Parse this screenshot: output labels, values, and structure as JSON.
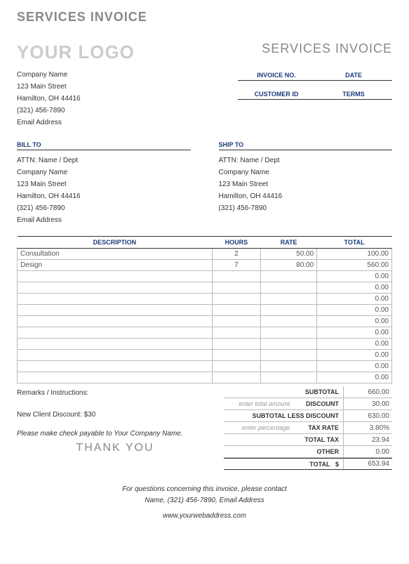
{
  "top_title": "SERVICES INVOICE",
  "logo": "YOUR LOGO",
  "invoice_title": "SERVICES INVOICE",
  "company": {
    "name": "Company Name",
    "street": "123 Main Street",
    "city": "Hamilton, OH  44416",
    "phone": "(321) 456-7890",
    "email": "Email Address"
  },
  "meta": {
    "invoice_no_label": "INVOICE NO.",
    "date_label": "DATE",
    "customer_id_label": "CUSTOMER ID",
    "terms_label": "TERMS"
  },
  "bill_to": {
    "title": "BILL TO",
    "attn": "ATTN: Name / Dept",
    "company": "Company Name",
    "street": "123 Main Street",
    "city": "Hamilton, OH  44416",
    "phone": "(321) 456-7890",
    "email": "Email Address"
  },
  "ship_to": {
    "title": "SHIP TO",
    "attn": "ATTN: Name / Dept",
    "company": "Company Name",
    "street": "123 Main Street",
    "city": "Hamilton, OH  44416",
    "phone": "(321) 456-7890"
  },
  "table": {
    "headers": {
      "description": "DESCRIPTION",
      "hours": "HOURS",
      "rate": "RATE",
      "total": "TOTAL"
    },
    "rows": [
      {
        "desc": "Consultation",
        "hours": "2",
        "rate": "50.00",
        "total": "100.00"
      },
      {
        "desc": "Design",
        "hours": "7",
        "rate": "80.00",
        "total": "560.00"
      },
      {
        "desc": "",
        "hours": "",
        "rate": "",
        "total": "0.00"
      },
      {
        "desc": "",
        "hours": "",
        "rate": "",
        "total": "0.00"
      },
      {
        "desc": "",
        "hours": "",
        "rate": "",
        "total": "0.00"
      },
      {
        "desc": "",
        "hours": "",
        "rate": "",
        "total": "0.00"
      },
      {
        "desc": "",
        "hours": "",
        "rate": "",
        "total": "0.00"
      },
      {
        "desc": "",
        "hours": "",
        "rate": "",
        "total": "0.00"
      },
      {
        "desc": "",
        "hours": "",
        "rate": "",
        "total": "0.00"
      },
      {
        "desc": "",
        "hours": "",
        "rate": "",
        "total": "0.00"
      },
      {
        "desc": "",
        "hours": "",
        "rate": "",
        "total": "0.00"
      },
      {
        "desc": "",
        "hours": "",
        "rate": "",
        "total": "0.00"
      }
    ]
  },
  "remarks_label": "Remarks / Instructions:",
  "remarks_text": "New Client Discount: $30",
  "payable": "Please make check payable to Your Company Name.",
  "thanks": "THANK YOU",
  "totals": {
    "subtotal": {
      "label": "SUBTOTAL",
      "value": "660.00"
    },
    "discount": {
      "hint": "enter total amount",
      "label": "DISCOUNT",
      "value": "30.00"
    },
    "subtotal_less": {
      "label": "SUBTOTAL LESS DISCOUNT",
      "value": "630.00"
    },
    "tax_rate": {
      "hint": "enter percentage",
      "label": "TAX RATE",
      "value": "3.80%"
    },
    "total_tax": {
      "label": "TOTAL TAX",
      "value": "23.94"
    },
    "other": {
      "label": "OTHER",
      "value": "0.00"
    },
    "grand": {
      "label": "TOTAL",
      "currency": "$",
      "value": "653.94"
    }
  },
  "footer": {
    "line1": "For questions concerning this invoice, please contact",
    "line2": "Name, (321) 456-7890, Email Address",
    "web": "www.yourwebaddress.com"
  }
}
